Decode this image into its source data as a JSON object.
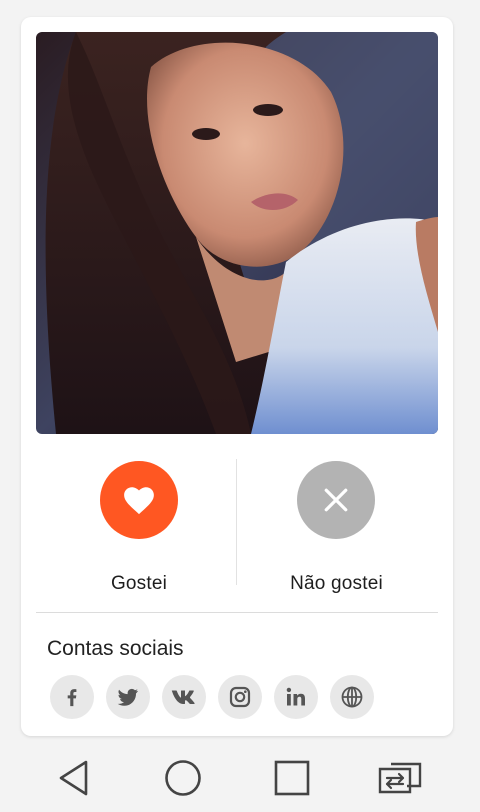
{
  "profile": {
    "photo_alt": "Profile photo"
  },
  "actions": {
    "like_label": "Gostei",
    "dislike_label": "Não gostei",
    "like_color": "#ff5722",
    "dislike_color": "#b3b3b3"
  },
  "social": {
    "title": "Contas sociais",
    "icons": [
      "facebook-icon",
      "twitter-icon",
      "vk-icon",
      "instagram-icon",
      "linkedin-icon",
      "globe-icon"
    ]
  },
  "navbar": {
    "icons": [
      "back-triangle-icon",
      "home-circle-icon",
      "recents-square-icon",
      "screen-switch-icon"
    ]
  }
}
